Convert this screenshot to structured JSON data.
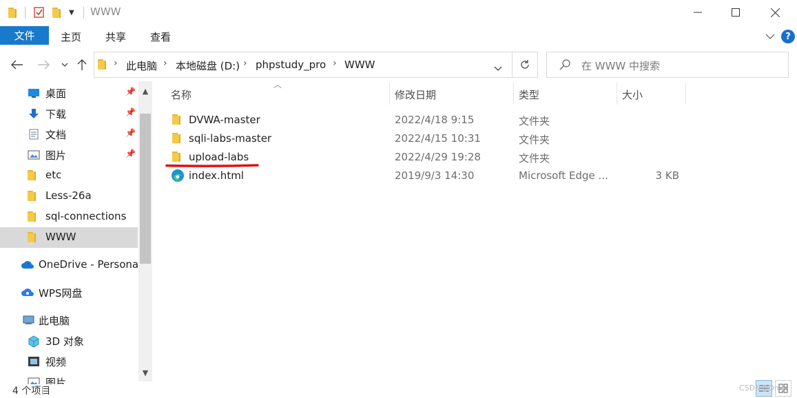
{
  "window": {
    "title": "WWW",
    "minimize_icon": "minimize-icon",
    "maximize_icon": "maximize-icon",
    "close_icon": "close-icon"
  },
  "ribbon": {
    "tabs": [
      {
        "label": "文件"
      },
      {
        "label": "主页"
      },
      {
        "label": "共享"
      },
      {
        "label": "查看"
      }
    ],
    "active_tab": "文件",
    "active_color": "#1979ca",
    "help_label": "?"
  },
  "address": {
    "crumbs": [
      "此电脑",
      "本地磁盘 (D:)",
      "phpstudy_pro",
      "WWW"
    ]
  },
  "search": {
    "placeholder": "在 WWW 中搜索"
  },
  "nav": {
    "items": [
      {
        "label": "桌面",
        "icon": "desktop-icon",
        "pinned": true
      },
      {
        "label": "下载",
        "icon": "download-icon",
        "pinned": true
      },
      {
        "label": "文档",
        "icon": "document-icon",
        "pinned": true
      },
      {
        "label": "图片",
        "icon": "picture-icon",
        "pinned": true
      },
      {
        "label": "etc",
        "icon": "folder-icon",
        "pinned": false
      },
      {
        "label": "Less-26a",
        "icon": "folder-icon",
        "pinned": false
      },
      {
        "label": "sql-connections",
        "icon": "folder-icon",
        "pinned": false
      },
      {
        "label": "WWW",
        "icon": "folder-icon",
        "pinned": false,
        "selected": true
      },
      {
        "label": "OneDrive - Personal",
        "icon": "onedrive-icon"
      },
      {
        "label": "WPS网盘",
        "icon": "wps-cloud-icon"
      },
      {
        "label": "此电脑",
        "icon": "computer-icon"
      },
      {
        "label": "3D 对象",
        "icon": "3d-objects-icon"
      },
      {
        "label": "视频",
        "icon": "video-icon"
      },
      {
        "label": "图片",
        "icon": "picture-icon"
      }
    ]
  },
  "columns": {
    "name": "名称",
    "modified": "修改日期",
    "type": "类型",
    "size": "大小"
  },
  "files": [
    {
      "name": "DVWA-master",
      "modified": "2022/4/18 9:15",
      "type": "文件夹",
      "size": "",
      "icon": "folder-icon"
    },
    {
      "name": "sqli-labs-master",
      "modified": "2022/4/15 10:31",
      "type": "文件夹",
      "size": "",
      "icon": "folder-icon"
    },
    {
      "name": "upload-labs",
      "modified": "2022/4/29 19:28",
      "type": "文件夹",
      "size": "",
      "icon": "folder-icon"
    },
    {
      "name": "index.html",
      "modified": "2019/9/3 14:30",
      "type": "Microsoft Edge ...",
      "size": "3 KB",
      "icon": "edge-icon"
    }
  ],
  "annotation": {
    "underline_color": "#e01010"
  },
  "status": {
    "item_count": "4 个项目",
    "watermark": "CSDN@Dmir"
  }
}
